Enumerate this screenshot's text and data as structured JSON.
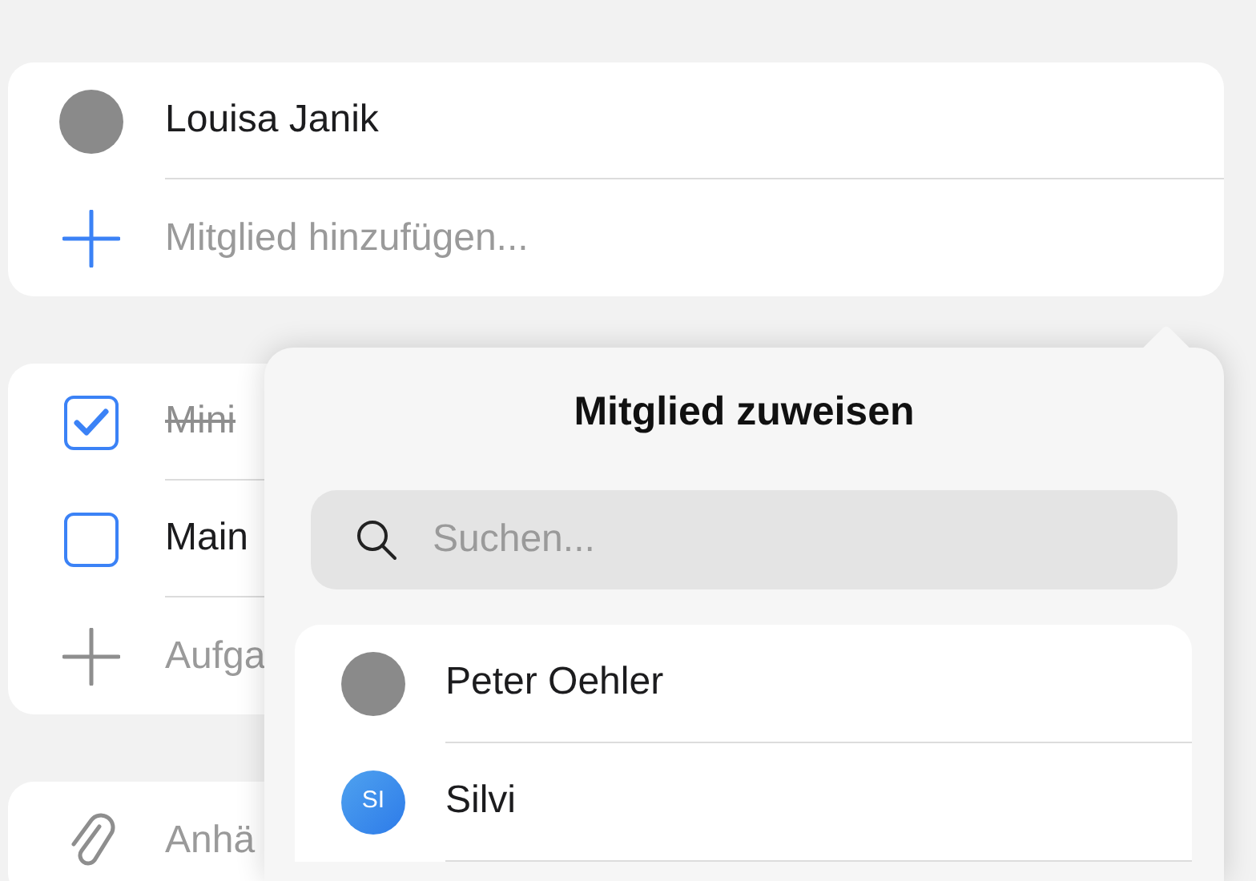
{
  "members_card": {
    "members": [
      {
        "name": "Louisa Janik",
        "kind": "photo"
      }
    ],
    "add_label": "Mitglied hinzufügen..."
  },
  "tasks_card": {
    "tasks": [
      {
        "title": "Mini",
        "checked": true
      },
      {
        "title": "Main",
        "checked": false
      }
    ],
    "add_label": "Aufga"
  },
  "attachments_card": {
    "label": "Anhä"
  },
  "popover": {
    "title": "Mitglied zuweisen",
    "search": {
      "placeholder": "Suchen..."
    },
    "people": [
      {
        "name": "Peter Oehler",
        "kind": "photo"
      },
      {
        "name": "Silvi",
        "kind": "initials",
        "initials": "SI"
      }
    ]
  }
}
